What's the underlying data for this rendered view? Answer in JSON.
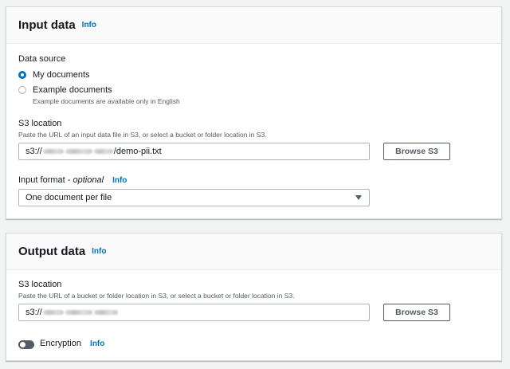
{
  "input_panel": {
    "title": "Input data",
    "info": "Info",
    "data_source_label": "Data source",
    "options": [
      {
        "label": "My documents",
        "selected": true
      },
      {
        "label": "Example documents",
        "selected": false,
        "description": "Example documents are available only in English"
      }
    ],
    "s3_label": "S3 location",
    "s3_description": "Paste the URL of an input data file in S3, or select a bucket or folder location in S3.",
    "s3_prefix": "s3://",
    "s3_suffix": "/demo-pii.txt",
    "browse_label": "Browse S3",
    "format_label": "Input format - ",
    "format_optional": "optional",
    "format_info": "Info",
    "format_value": "One document per file"
  },
  "output_panel": {
    "title": "Output data",
    "info": "Info",
    "s3_label": "S3 location",
    "s3_description": "Paste the URL of a bucket or folder location in S3, or select a bucket or folder location in S3.",
    "s3_prefix": "s3://",
    "browse_label": "Browse S3",
    "encryption_label": "Encryption",
    "encryption_info": "Info",
    "encryption_enabled": false
  },
  "colors": {
    "link": "#0073bb",
    "radio_selected": "#0073bb",
    "text": "#16191f",
    "muted": "#545b64"
  }
}
